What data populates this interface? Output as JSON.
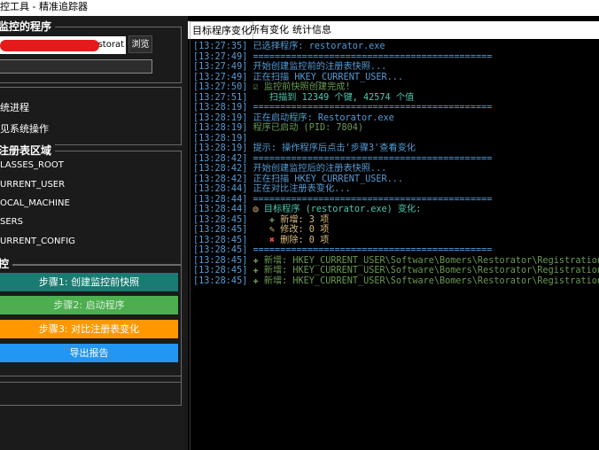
{
  "window": {
    "title": "控工具 - 精准追踪器"
  },
  "monitor_group": {
    "legend": "监控的程序",
    "path_value": "storat",
    "browse_label": "浏览"
  },
  "options": {
    "items": [
      "统进程",
      "见系统操作"
    ]
  },
  "registry_group": {
    "legend": "注册表区域",
    "hives": [
      "LASSES_ROOT",
      "URRENT_USER",
      "OCAL_MACHINE",
      "SERS",
      "URRENT_CONFIG"
    ]
  },
  "control_group": {
    "legend": "控",
    "step1_label": "步骤1: 创建监控前快照",
    "step2_label": "步骤2: 启动程序",
    "step3_label": "步骤3: 对比注册表变化",
    "export_label": "导出报告"
  },
  "tabs": [
    {
      "label": "目标程序变化",
      "active": true
    },
    {
      "label": "所有变化",
      "active": false
    },
    {
      "label": "统计信息",
      "active": false
    }
  ],
  "colors": {
    "step1": "#1a7b73",
    "step2": "#4cae4f",
    "step3": "#ff9800",
    "export": "#2196f3"
  },
  "log": [
    {
      "ts": "[13:27:35]",
      "icon": "",
      "msg": "已选择程序: restorator.exe",
      "color": "blue"
    },
    {
      "ts": "[13:27:49]",
      "icon": "",
      "msg": "============================================",
      "color": "blue"
    },
    {
      "ts": "[13:27:49]",
      "icon": "",
      "msg": "开始创建监控前的注册表快照...",
      "color": "blue"
    },
    {
      "ts": "[13:27:49]",
      "icon": "",
      "msg": "正在扫描 HKEY_CURRENT_USER...",
      "color": "blue"
    },
    {
      "ts": "[13:27:50]",
      "icon": "☑",
      "msg": " 监控前快照创建完成!",
      "color": "green"
    },
    {
      "ts": "[13:27:51]",
      "icon": "",
      "msg": "   扫描到 12349 个键, 42574 个值",
      "color": "cyan"
    },
    {
      "ts": "[13:28:19]",
      "icon": "",
      "msg": "============================================",
      "color": "blue"
    },
    {
      "ts": "[13:28:19]",
      "icon": "",
      "msg": "正在启动程序: Restorator.exe",
      "color": "blue"
    },
    {
      "ts": "[13:28:19]",
      "icon": "",
      "msg": "程序已启动 (PID: 7804)",
      "color": "green"
    },
    {
      "ts": "[13:28:19]",
      "icon": "",
      "msg": "",
      "color": "blue"
    },
    {
      "ts": "[13:28:19]",
      "icon": "",
      "msg": "提示: 操作程序后点击'步骤3'查看变化",
      "color": "blue"
    },
    {
      "ts": "[13:28:42]",
      "icon": "",
      "msg": "============================================",
      "color": "blue"
    },
    {
      "ts": "[13:28:42]",
      "icon": "",
      "msg": "开始创建监控后的注册表快照...",
      "color": "blue"
    },
    {
      "ts": "[13:28:42]",
      "icon": "",
      "msg": "正在扫描 HKEY_CURRENT_USER...",
      "color": "blue"
    },
    {
      "ts": "[13:28:44]",
      "icon": "",
      "msg": "正在对比注册表变化...",
      "color": "blue"
    },
    {
      "ts": "[13:28:44]",
      "icon": "",
      "msg": "============================================",
      "color": "blue"
    },
    {
      "ts": "[13:28:44]",
      "icon": "◎",
      "msg": " 目标程序 (restorator.exe) 变化:",
      "color": "cyan"
    },
    {
      "ts": "[13:28:45]",
      "icon": "   ✚",
      "msg": " 新增: 3 项",
      "color": "yellow"
    },
    {
      "ts": "[13:28:45]",
      "icon": "   ✎",
      "msg": " 修改: 0 项",
      "color": "yellow"
    },
    {
      "ts": "[13:28:45]",
      "icon": "   ✖",
      "msg": " 删除: 0 项",
      "color": "yellow"
    },
    {
      "ts": "[13:28:45]",
      "icon": "",
      "msg": "============================================",
      "color": "blue"
    },
    {
      "ts": "[13:28:45]",
      "icon": "✚",
      "msg": " 新增: HKEY_CURRENT_USER\\Software\\Bomers\\Restorator\\Registration\\Na",
      "color": "green"
    },
    {
      "ts": "[13:28:45]",
      "icon": "✚",
      "msg": " 新增: HKEY_CURRENT_USER\\Software\\Bomers\\Restorator\\Registration\\Pu",
      "color": "green"
    },
    {
      "ts": "[13:28:45]",
      "icon": "✚",
      "msg": " 新增: HKEY_CURRENT_USER\\Software\\Bomers\\Restorator\\Registration\\Ty",
      "color": "green"
    }
  ]
}
